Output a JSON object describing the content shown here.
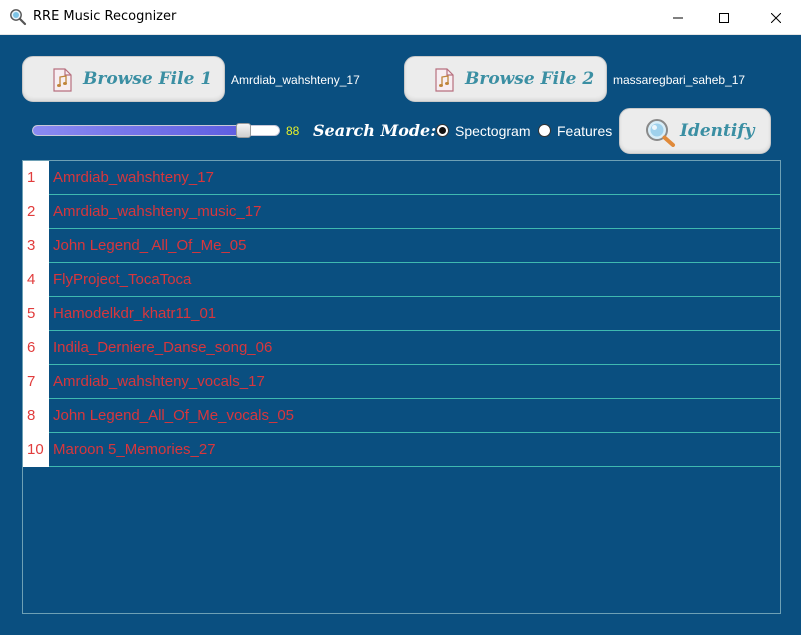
{
  "window": {
    "title": "RRE Music Recognizer",
    "icon": "magnifier-icon",
    "controls": [
      "minimize-icon",
      "maximize-icon",
      "close-icon"
    ]
  },
  "toolbar": {
    "browse_file_1_label": "Browse File 1",
    "browse_file_2_label": "Browse File 2",
    "file_1_name": "Amrdiab_wahshteny_17",
    "file_2_name": "massaregbari_saheb_17",
    "identify_label": "Identify"
  },
  "threshold": {
    "value": 88,
    "display": "88",
    "fill_fraction": 0.88
  },
  "search_mode": {
    "label": "Search Mode:",
    "options": [
      {
        "label": "Spectogram",
        "selected": true
      },
      {
        "label": "Features",
        "selected": false
      }
    ]
  },
  "results": [
    {
      "index": "1",
      "name": "Amrdiab_wahshteny_17"
    },
    {
      "index": "2",
      "name": "Amrdiab_wahshteny_music_17"
    },
    {
      "index": "3",
      "name": "John Legend_ All_Of_Me_05"
    },
    {
      "index": "4",
      "name": "FlyProject_TocaToca"
    },
    {
      "index": "5",
      "name": "Hamodelkdr_khatr11_01"
    },
    {
      "index": "6",
      "name": "Indila_Derniere_Danse_song_06"
    },
    {
      "index": "7",
      "name": "Amrdiab_wahshteny_vocals_17"
    },
    {
      "index": "8",
      "name": "John Legend_All_Of_Me_vocals_05"
    },
    {
      "index": "10",
      "name": "Maroon 5_Memories_27"
    }
  ],
  "colors": {
    "background": "#0a4f80",
    "button_text": "#3b8fa3",
    "result_text": "#d8363c",
    "row_divider": "#3fb9b0",
    "slider_value": "#e6f02a"
  }
}
